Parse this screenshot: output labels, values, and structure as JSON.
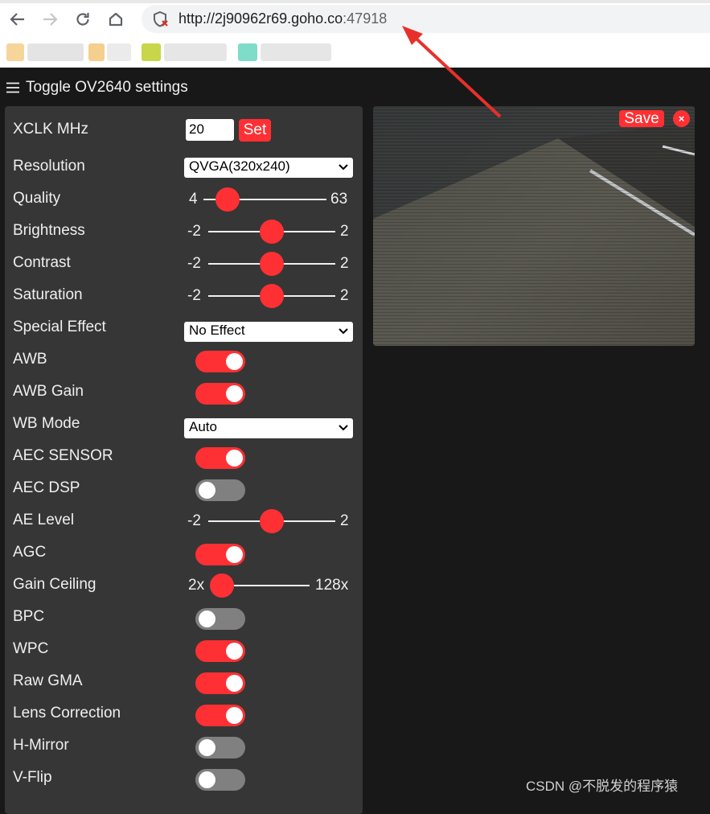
{
  "browser": {
    "url_main": "http://2j90962r69.goho.co",
    "url_port": ":47918"
  },
  "app": {
    "menu_icon": "hamburger-icon",
    "toggle_label": "Toggle OV2640 settings"
  },
  "controls": {
    "xclk": {
      "label": "XCLK MHz",
      "value": "20",
      "button": "Set"
    },
    "resolution": {
      "label": "Resolution",
      "selected": "QVGA(320x240)"
    },
    "quality": {
      "label": "Quality",
      "min": "4",
      "max": "63",
      "value": 10
    },
    "brightness": {
      "label": "Brightness",
      "min": "-2",
      "max": "2",
      "value": 0
    },
    "contrast": {
      "label": "Contrast",
      "min": "-2",
      "max": "2",
      "value": 0
    },
    "saturation": {
      "label": "Saturation",
      "min": "-2",
      "max": "2",
      "value": 0
    },
    "special_effect": {
      "label": "Special Effect",
      "selected": "No Effect"
    },
    "awb": {
      "label": "AWB",
      "on": true
    },
    "awb_gain": {
      "label": "AWB Gain",
      "on": true
    },
    "wb_mode": {
      "label": "WB Mode",
      "selected": "Auto"
    },
    "aec_sensor": {
      "label": "AEC SENSOR",
      "on": true
    },
    "aec_dsp": {
      "label": "AEC DSP",
      "on": false
    },
    "ae_level": {
      "label": "AE Level",
      "min": "-2",
      "max": "2",
      "value": 0
    },
    "agc": {
      "label": "AGC",
      "on": true
    },
    "gain_ceiling": {
      "label": "Gain Ceiling",
      "min": "2x",
      "max": "128x",
      "value": 0
    },
    "bpc": {
      "label": "BPC",
      "on": false
    },
    "wpc": {
      "label": "WPC",
      "on": true
    },
    "raw_gma": {
      "label": "Raw GMA",
      "on": true
    },
    "lens_correction": {
      "label": "Lens Correction",
      "on": true
    },
    "h_mirror": {
      "label": "H-Mirror",
      "on": false
    },
    "v_flip": {
      "label": "V-Flip",
      "on": false
    }
  },
  "stream": {
    "save_label": "Save",
    "close_label": "×"
  },
  "watermark": "CSDN @不脱发的程序猿",
  "colors": {
    "accent": "#ff3034",
    "panel": "#363636",
    "background": "#181818",
    "switch_off": "#808080",
    "annotation_arrow": "#e8302a"
  }
}
